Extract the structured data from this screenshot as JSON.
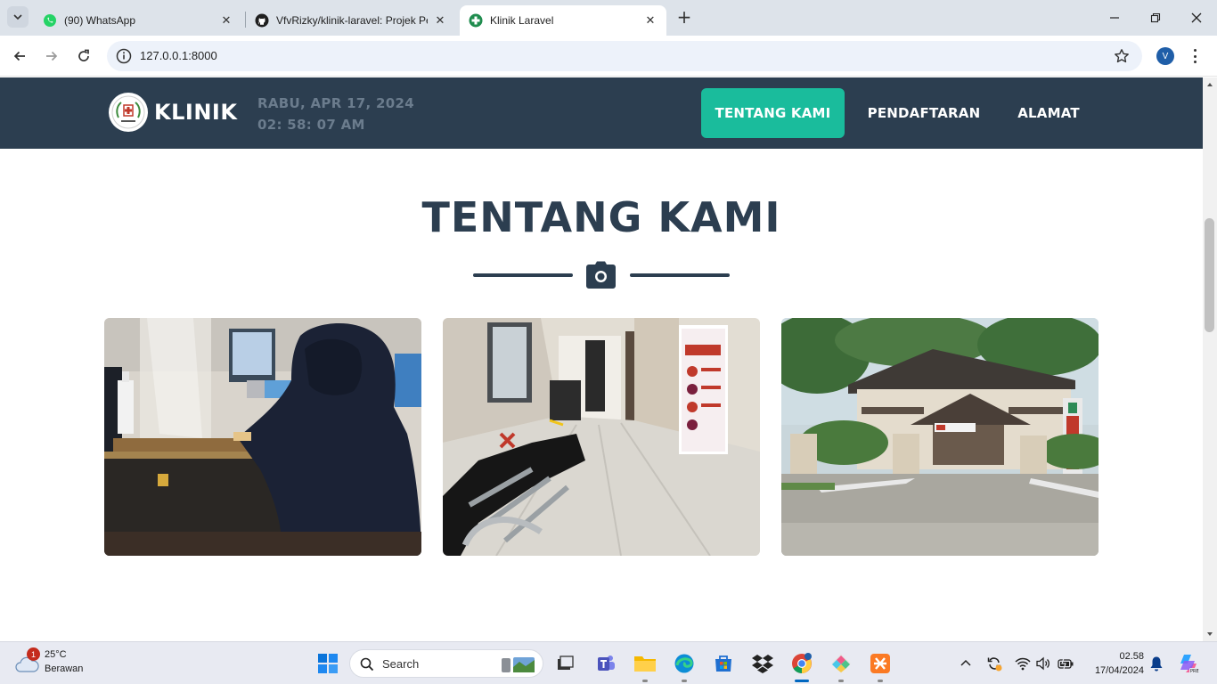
{
  "browser": {
    "tabs": [
      {
        "title": "(90) WhatsApp",
        "icon": "whatsapp-icon"
      },
      {
        "title": "VfvRizky/klinik-laravel: Projek Pe",
        "icon": "github-icon"
      },
      {
        "title": "Klinik Laravel",
        "icon": "clinic-cross-icon"
      }
    ],
    "url": "127.0.0.1:8000",
    "profile_initial": "V"
  },
  "site": {
    "brand": "KLINIK",
    "clock_date": "RABU, APR 17, 2024",
    "clock_time": "02: 58: 07 AM",
    "nav": [
      "TENTANG KAMI",
      "PENDAFTARAN",
      "ALAMAT"
    ],
    "active_nav": "TENTANG KAMI",
    "section_title": "TENTANG KAMI",
    "divider_icon": "camera-icon",
    "photos": [
      "reception-desk-photo",
      "waiting-hallway-photo",
      "clinic-building-photo"
    ],
    "colors": {
      "navbar": "#2c3e50",
      "accent": "#1abc9c",
      "title": "#2c3e50"
    }
  },
  "taskbar": {
    "weather_temp": "25°C",
    "weather_condition": "Berawan",
    "weather_badge": "1",
    "search_label": "Search",
    "time": "02.58",
    "date": "17/04/2024"
  }
}
